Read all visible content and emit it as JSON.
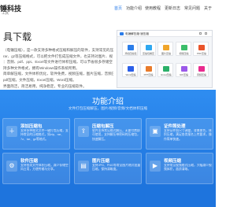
{
  "header": {
    "logo_title": "锤科技",
    "logo_sub": "工具",
    "nav": [
      {
        "label": "首页",
        "active": true
      },
      {
        "label": "功能介绍",
        "active": false
      },
      {
        "label": "使用教程",
        "active": false
      },
      {
        "label": "更新日志",
        "active": false
      },
      {
        "label": "常见问题",
        "active": false
      },
      {
        "label": "关于",
        "active": false
      }
    ]
  },
  "hero": {
    "title": "具下载",
    "lines": [
      "（电锤压缩），是一款支持多种格式压缩和解压的软件，支持常见的压缩格式，",
      "rar、gz等压缩格式，可以把文件打包成压缩文件，也支持对图片、视",
      "：音频、pdf、ppt、Excel等文件进行体积压缩，可以节省很多存储空",
      "持多种文件格式，拥有Windows操作系统所用。",
      "简单解压缩，文件体积优化，软件免费，视频压缩，图片压缩，音频压缩，",
      "pdf压缩，文件压缩，Excel压缩，Word压缩。",
      "界面简洁，简洁易用，纯净稳定，专业的压缩软件。",
      "http://www.dianchui.com/windows(x1)"
    ]
  },
  "screenshot": {
    "title": "电锤解压缩·速压缩",
    "tiles": [
      {
        "label": "添加压缩包",
        "color": "#2b7de9"
      },
      {
        "label": "压缩包解压",
        "color": "#2fa8f0"
      },
      {
        "label": "图片压缩",
        "color": "#f0a52b"
      },
      {
        "label": "视频压缩",
        "color": "#3bbd6a"
      },
      {
        "label": "PDF压缩",
        "color": "#e9542b"
      },
      {
        "label": "Word压缩",
        "color": "#2b5fe9"
      },
      {
        "label": "PPT压缩",
        "color": "#e97b2b"
      },
      {
        "label": "Excel压缩",
        "color": "#2bb069"
      },
      {
        "label": "GIF压缩",
        "color": "#9b59e9"
      },
      {
        "label": "音频压缩",
        "color": "#e92b8f"
      }
    ]
  },
  "features": {
    "title": "功能介绍",
    "subtitle": "文件打包压缩解压，图片/视频/音频/文档体积压缩",
    "cards": [
      {
        "title": "添加压缩包",
        "desc": "支持多种格式文件一键打包压缩，支持常见的压缩格式，如zip、rar、7z、tar、gz等格式。",
        "icon": "＋"
      },
      {
        "title": "压缩包解压",
        "desc": "软件支持常见格式解压，无需付费即可使用，支持解压带密码的压缩包，快速解压。",
        "icon": "⇪"
      },
      {
        "title": "证件照处理",
        "desc": "支持证件照尺寸调整，背景换色，体积压缩，满足各类报名上传要求，操作简单快速。",
        "icon": "▣"
      },
      {
        "title": "软件压缩",
        "desc": "支持各类文件体积压缩，减少存储空间占用，方便传输与分享。",
        "icon": "⚙"
      },
      {
        "title": "图片压缩",
        "desc": "支持JPG、PNG等常见图片格式批量压缩，保持清晰度。",
        "icon": "▤"
      },
      {
        "title": "视频压缩",
        "desc": "支持常见视频格式压缩，大幅减少视频体积，画质清晰。",
        "icon": "▶"
      }
    ]
  }
}
